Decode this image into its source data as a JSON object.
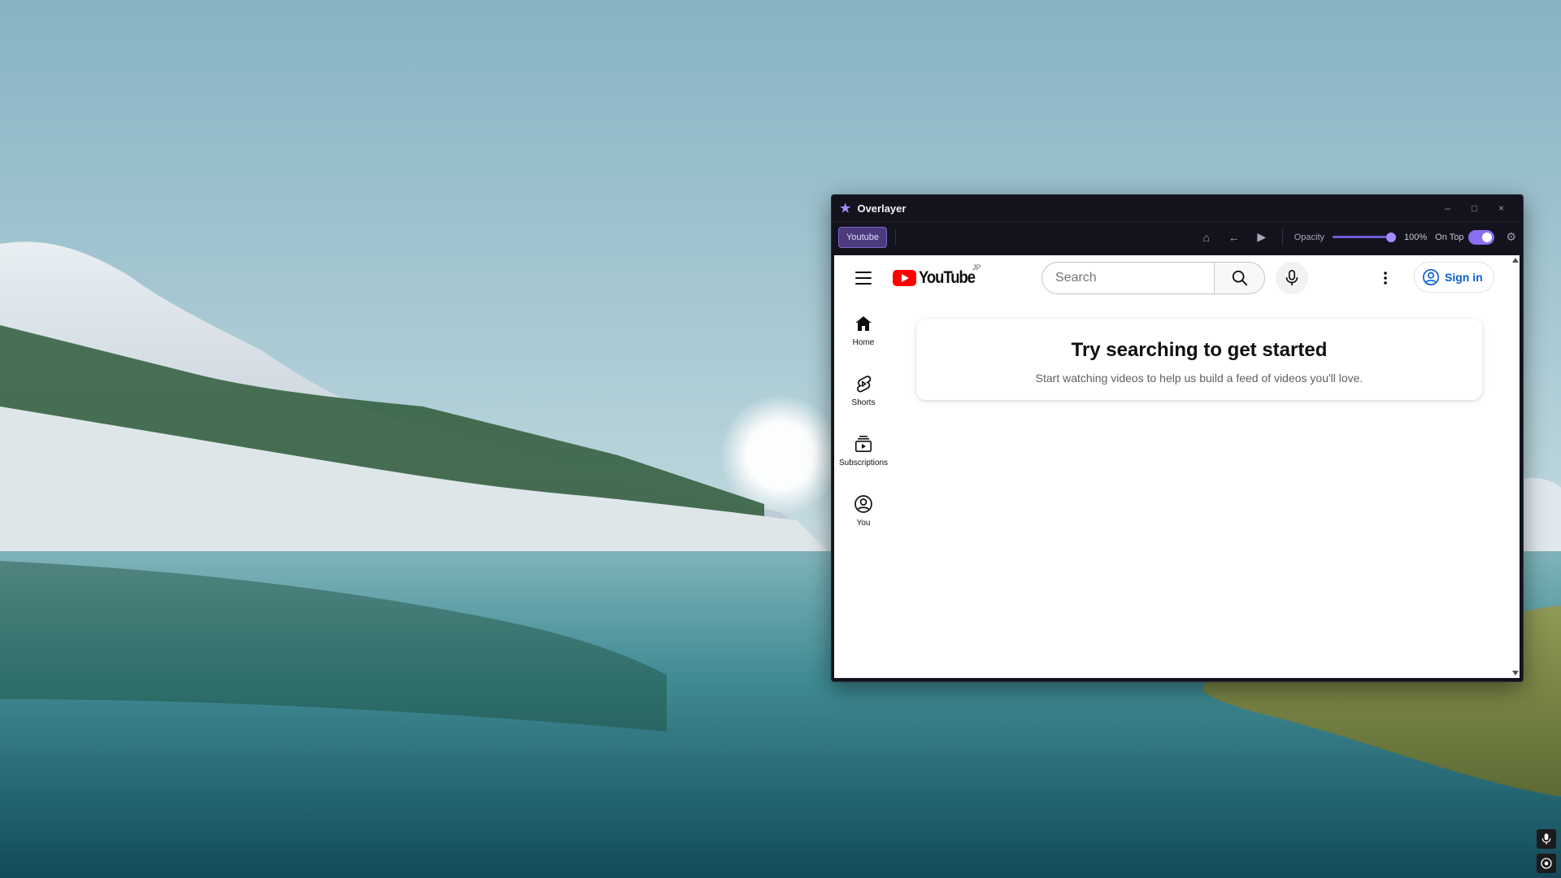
{
  "window": {
    "title": "Overlayer",
    "app_icon": "star-icon",
    "controls": {
      "minimize": "–",
      "maximize": "□",
      "close": "×"
    }
  },
  "toolbar": {
    "tab_label": "Youtube",
    "home_icon": "⌂",
    "back_icon": "←",
    "play_icon": "▶",
    "opacity_label": "Opacity",
    "opacity_value": "100%",
    "opacity_fraction": 1.0,
    "ontop_label": "On Top",
    "ontop_enabled": true,
    "settings_icon": "⚙"
  },
  "youtube": {
    "logo_text": "YouTube",
    "region": "JP",
    "search_placeholder": "Search",
    "search_value": "",
    "signin_label": "Sign in",
    "sidebar": [
      {
        "label": "Home",
        "icon": "home-icon"
      },
      {
        "label": "Shorts",
        "icon": "shorts-icon"
      },
      {
        "label": "Subscriptions",
        "icon": "subscriptions-icon"
      },
      {
        "label": "You",
        "icon": "account-icon"
      }
    ],
    "empty_title": "Try searching to get started",
    "empty_subtitle": "Start watching videos to help us build a feed of videos you'll love."
  },
  "colors": {
    "accent": "#8a6ff0",
    "youtube_red": "#ff0000",
    "link_blue": "#065fd4",
    "window_bg": "#13131d"
  }
}
